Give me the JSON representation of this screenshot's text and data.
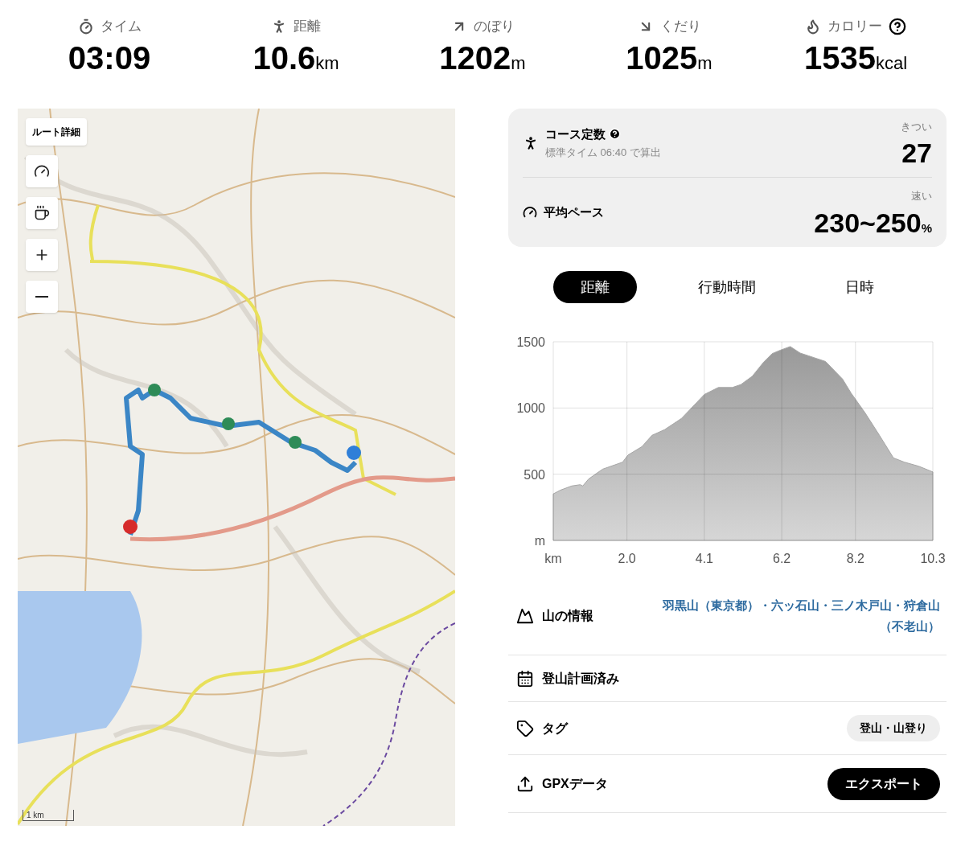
{
  "stats": [
    {
      "kind": "time",
      "label": "タイム",
      "value": "03:09",
      "help": false
    },
    {
      "kind": "distance",
      "label": "距離",
      "value": "10.6",
      "unit": "km",
      "help": false
    },
    {
      "kind": "ascent",
      "label": "のぼり",
      "value": "1202",
      "unit": "m",
      "help": false
    },
    {
      "kind": "descent",
      "label": "くだり",
      "value": "1025",
      "unit": "m",
      "help": false
    },
    {
      "kind": "calories",
      "label": "カロリー",
      "value": "1535",
      "unit": "kcal",
      "help": true
    }
  ],
  "map": {
    "kind": "picture",
    "route_button": "ルート詳細",
    "controls": [
      {
        "kind": "pace"
      },
      {
        "kind": "break"
      },
      {
        "kind": "zoom_in"
      },
      {
        "kind": "zoom_out"
      }
    ],
    "scale": "1 km"
  },
  "summary": {
    "course": {
      "label": "コース定数",
      "sub": "標準タイム 06:40 で算出",
      "rating": "きつい",
      "value": "27"
    },
    "pace": {
      "label": "平均ペース",
      "rating": "速い",
      "value": "230~250",
      "unit": "%"
    }
  },
  "tabs": [
    {
      "label": "距離",
      "selected": true
    },
    {
      "label": "行動時間",
      "selected": false
    },
    {
      "label": "日時",
      "selected": false
    }
  ],
  "elevation": {
    "chart_data": {
      "type": "area",
      "x": [
        0,
        0.19,
        0.5,
        0.73,
        0.8,
        0.96,
        1.34,
        1.88,
        2.03,
        2.41,
        2.68,
        3.02,
        3.48,
        4.1,
        4.48,
        4.86,
        5.09,
        5.4,
        5.71,
        5.94,
        6.16,
        6.43,
        6.7,
        6.93,
        7.39,
        7.85,
        8.08,
        8.46,
        8.85,
        9.23,
        9.53,
        9.92,
        10.3
      ],
      "grid": true,
      "series": [
        {
          "color": "#a6a6a6",
          "values": [
            351,
            379,
            411,
            421,
            411,
            464,
            538,
            591,
            645,
            709,
            794,
            836,
            921,
            1102,
            1155,
            1155,
            1177,
            1240,
            1347,
            1411,
            1436,
            1464,
            1415,
            1394,
            1351,
            1219,
            1113,
            964,
            794,
            623,
            591,
            560,
            517
          ]
        }
      ],
      "xlim": [
        0,
        10.3
      ],
      "ylim": [
        0,
        1500
      ],
      "xticks": [
        {
          "value": 0,
          "label": "km"
        },
        {
          "value": 2,
          "label": "2.0"
        },
        4.1,
        6.2,
        8.2,
        10.3
      ],
      "yticks": [
        {
          "value": 0,
          "label": "m"
        },
        {
          "value": 500,
          "label": "500"
        },
        {
          "value": 1000,
          "label": "1000"
        },
        {
          "value": 1500,
          "label": "1500"
        }
      ]
    }
  },
  "info": [
    {
      "kind": "mountains",
      "label": "山の情報",
      "value": "羽黒山（東京都）・六ッ石山・三ノ木戸山・狩倉山（不老山）"
    },
    {
      "kind": "plan",
      "label": "登山計画済み"
    },
    {
      "kind": "tag",
      "label": "タグ",
      "value": "登山・山登り"
    },
    {
      "kind": "gpx",
      "label": "GPXデータ",
      "value": "エクスポート"
    }
  ]
}
